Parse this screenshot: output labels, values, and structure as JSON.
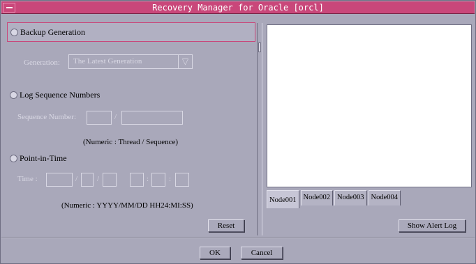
{
  "window": {
    "title": "Recovery Manager for Oracle [orcl]"
  },
  "backup_generation": {
    "label": "Backup Generation",
    "generation_label": "Generation:",
    "generation_value": "The Latest Generation",
    "arrow": "▽"
  },
  "log_sequence": {
    "label": "Log Sequence Numbers",
    "sequence_label": "Sequence Number:",
    "separator": "/",
    "hint": "(Numeric : Thread / Sequence)"
  },
  "point_in_time": {
    "label": "Point-in-Time",
    "time_label": "Time :",
    "date_sep": "/",
    "time_sep": ":",
    "hint": "(Numeric : YYYY/MM/DD HH24:MI:SS)"
  },
  "buttons": {
    "reset": "Reset",
    "show_alert_log": "Show Alert Log",
    "ok": "OK",
    "cancel": "Cancel"
  },
  "tabs": [
    {
      "label": "Node001",
      "active": true
    },
    {
      "label": "Node002",
      "active": false
    },
    {
      "label": "Node003",
      "active": false
    },
    {
      "label": "Node004",
      "active": false
    }
  ]
}
